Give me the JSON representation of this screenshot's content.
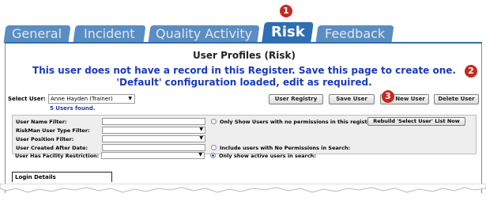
{
  "tabs": [
    {
      "label": "General",
      "active": false
    },
    {
      "label": "Incident",
      "active": false
    },
    {
      "label": "Quality Activity",
      "active": false
    },
    {
      "label": "Risk",
      "active": true
    },
    {
      "label": "Feedback",
      "active": false
    }
  ],
  "callouts": [
    "1",
    "2",
    "3"
  ],
  "page": {
    "title": "User Profiles (Risk)",
    "message_line1": "This user does not have a record in this Register. Save this page to create one.",
    "message_line2": "'Default' configuration loaded, edit as required."
  },
  "select_user": {
    "label": "Select User:",
    "value": "Anne Hayden (Trainer)",
    "users_found": "5 Users found."
  },
  "buttons": {
    "user_registry": "User Registry",
    "save_user": "Save User",
    "new_user": "New User",
    "delete_user": "Delete User"
  },
  "filters": {
    "user_name": "User Name Filter:",
    "riskman_type": "RiskMan User Type Filter:",
    "user_position": "User Position Filter:",
    "created_after": "User Created After Date:",
    "facility_restriction": "User Has Facility Restriction:",
    "opt_no_permissions_register": "Only Show Users with no permissions in this register:",
    "rebuild_button": "Rebuild 'Select User' List Now",
    "opt_include_no_permissions": "Include users with No Permissions in Search:",
    "opt_active_only": "Only show active users in search:",
    "opt_active_only_selected": true
  },
  "login_details": "Login Details",
  "colors": {
    "tab": "#5b8dc1",
    "tab_active": "#2e6fb1",
    "message": "#1a3bb8",
    "callout": "#c8281f"
  }
}
